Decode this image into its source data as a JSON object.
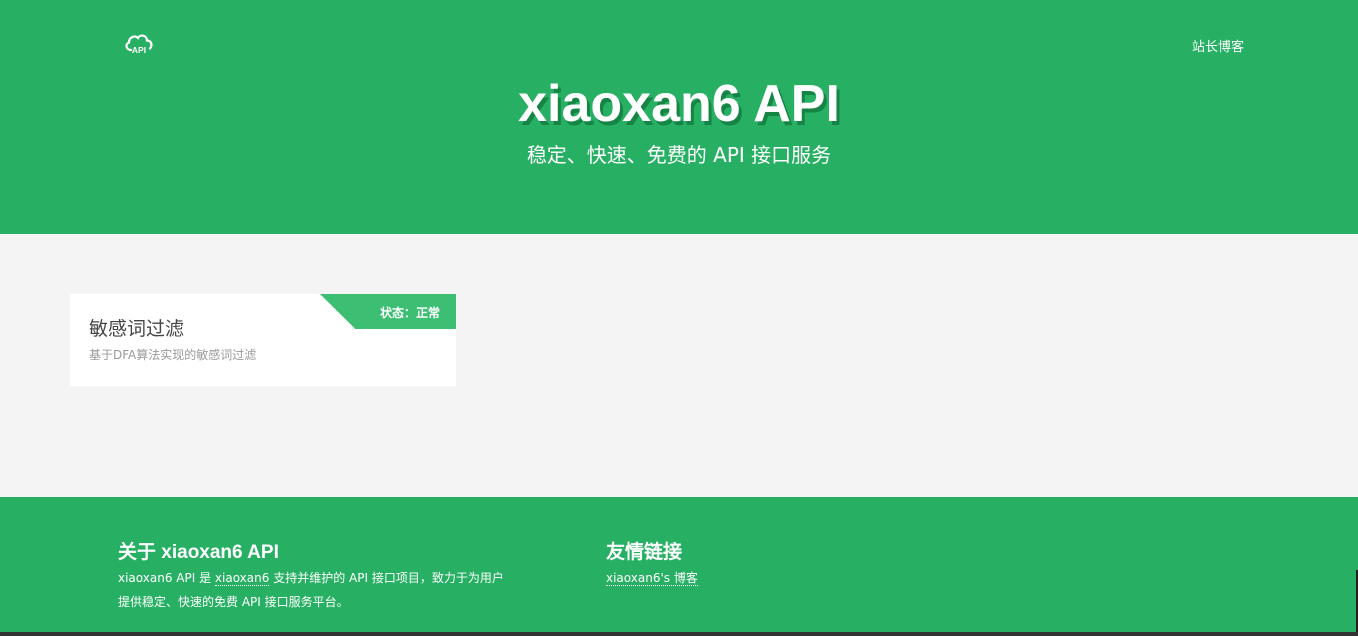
{
  "header": {
    "logo_icon": "cloud-api-icon",
    "nav_link": "站长博客",
    "title": "xiaoxan6 API",
    "subtitle": "稳定、快速、免费的 API 接口服务"
  },
  "cards": [
    {
      "title": "敏感词过滤",
      "description": "基于DFA算法实现的敏感词过滤",
      "status": "状态：正常"
    }
  ],
  "footer": {
    "about": {
      "heading": "关于 xiaoxan6 API",
      "line1_a": "xiaoxan6 API 是",
      "line1_link": "xiaoxan6",
      "line1_b": "支持并维护的 API 接口项目，致力于为用户",
      "line2": "提供稳定、快速的免费 API 接口服务平台。"
    },
    "friends": {
      "heading": "友情链接",
      "link": "xiaoxan6's 博客"
    }
  },
  "colors": {
    "brand_green": "#27b063",
    "status_green": "#3cbf73",
    "page_bg": "#f4f4f4"
  }
}
